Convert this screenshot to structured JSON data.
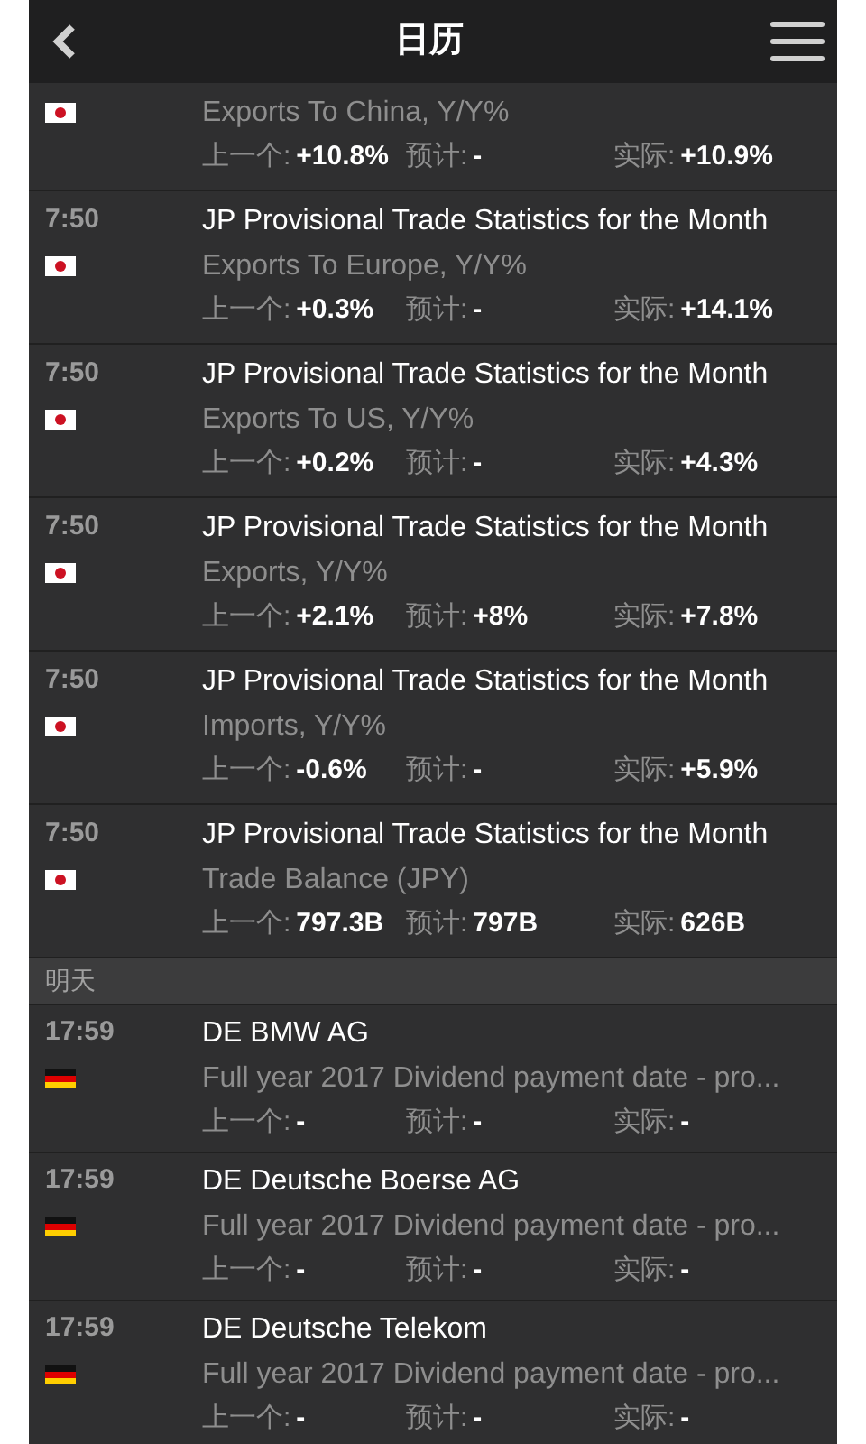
{
  "header": {
    "title": "日历"
  },
  "sections": [
    {
      "items": [
        {
          "kind": "jp",
          "subtitle": "Exports To China, Y/Y%",
          "stats": [
            {
              "label": "上一个:",
              "value": "+10.8%"
            },
            {
              "label": "预计:",
              "value": "-"
            },
            {
              "label": "实际:",
              "value": "+10.9%"
            }
          ]
        },
        {
          "time": "7:50",
          "kind": "jp",
          "title": "JP Provisional Trade Statistics for the Month",
          "subtitle": "Exports To Europe, Y/Y%",
          "stats": [
            {
              "label": "上一个:",
              "value": "+0.3%"
            },
            {
              "label": "预计:",
              "value": "-"
            },
            {
              "label": "实际:",
              "value": "+14.1%"
            }
          ]
        },
        {
          "time": "7:50",
          "kind": "jp",
          "title": "JP Provisional Trade Statistics for the Month",
          "subtitle": "Exports To US, Y/Y%",
          "stats": [
            {
              "label": "上一个:",
              "value": "+0.2%"
            },
            {
              "label": "预计:",
              "value": "-"
            },
            {
              "label": "实际:",
              "value": "+4.3%"
            }
          ]
        },
        {
          "time": "7:50",
          "kind": "jp",
          "title": "JP Provisional Trade Statistics for the Month",
          "subtitle": "Exports, Y/Y%",
          "stats": [
            {
              "label": "上一个:",
              "value": "+2.1%"
            },
            {
              "label": "预计:",
              "value": "+8%"
            },
            {
              "label": "实际:",
              "value": "+7.8%"
            }
          ]
        },
        {
          "time": "7:50",
          "kind": "jp",
          "title": "JP Provisional Trade Statistics for the Month",
          "subtitle": "Imports, Y/Y%",
          "stats": [
            {
              "label": "上一个:",
              "value": "-0.6%"
            },
            {
              "label": "预计:",
              "value": "-"
            },
            {
              "label": "实际:",
              "value": "+5.9%"
            }
          ]
        },
        {
          "time": "7:50",
          "kind": "jp",
          "title": "JP Provisional Trade Statistics for the Month",
          "subtitle": "Trade Balance (JPY)",
          "stats": [
            {
              "label": "上一个:",
              "value": "797.3B"
            },
            {
              "label": "预计:",
              "value": "797B"
            },
            {
              "label": "实际:",
              "value": "626B"
            }
          ]
        }
      ]
    },
    {
      "label": "明天",
      "items": [
        {
          "time": "17:59",
          "kind": "de",
          "title": "DE BMW AG",
          "subtitle": "Full year 2017 Dividend payment date - pro...",
          "stats": [
            {
              "label": "上一个:",
              "value": "-"
            },
            {
              "label": "预计:",
              "value": "-"
            },
            {
              "label": "实际:",
              "value": "-"
            }
          ]
        },
        {
          "time": "17:59",
          "kind": "de",
          "title": "DE Deutsche Boerse AG",
          "subtitle": "Full year 2017 Dividend payment date - pro...",
          "stats": [
            {
              "label": "上一个:",
              "value": "-"
            },
            {
              "label": "预计:",
              "value": "-"
            },
            {
              "label": "实际:",
              "value": "-"
            }
          ]
        },
        {
          "time": "17:59",
          "kind": "de",
          "title": "DE Deutsche Telekom",
          "subtitle": "Full year 2017 Dividend payment date - pro...",
          "stats": [
            {
              "label": "上一个:",
              "value": "-"
            },
            {
              "label": "预计:",
              "value": "-"
            },
            {
              "label": "实际:",
              "value": "-"
            }
          ]
        }
      ]
    }
  ]
}
